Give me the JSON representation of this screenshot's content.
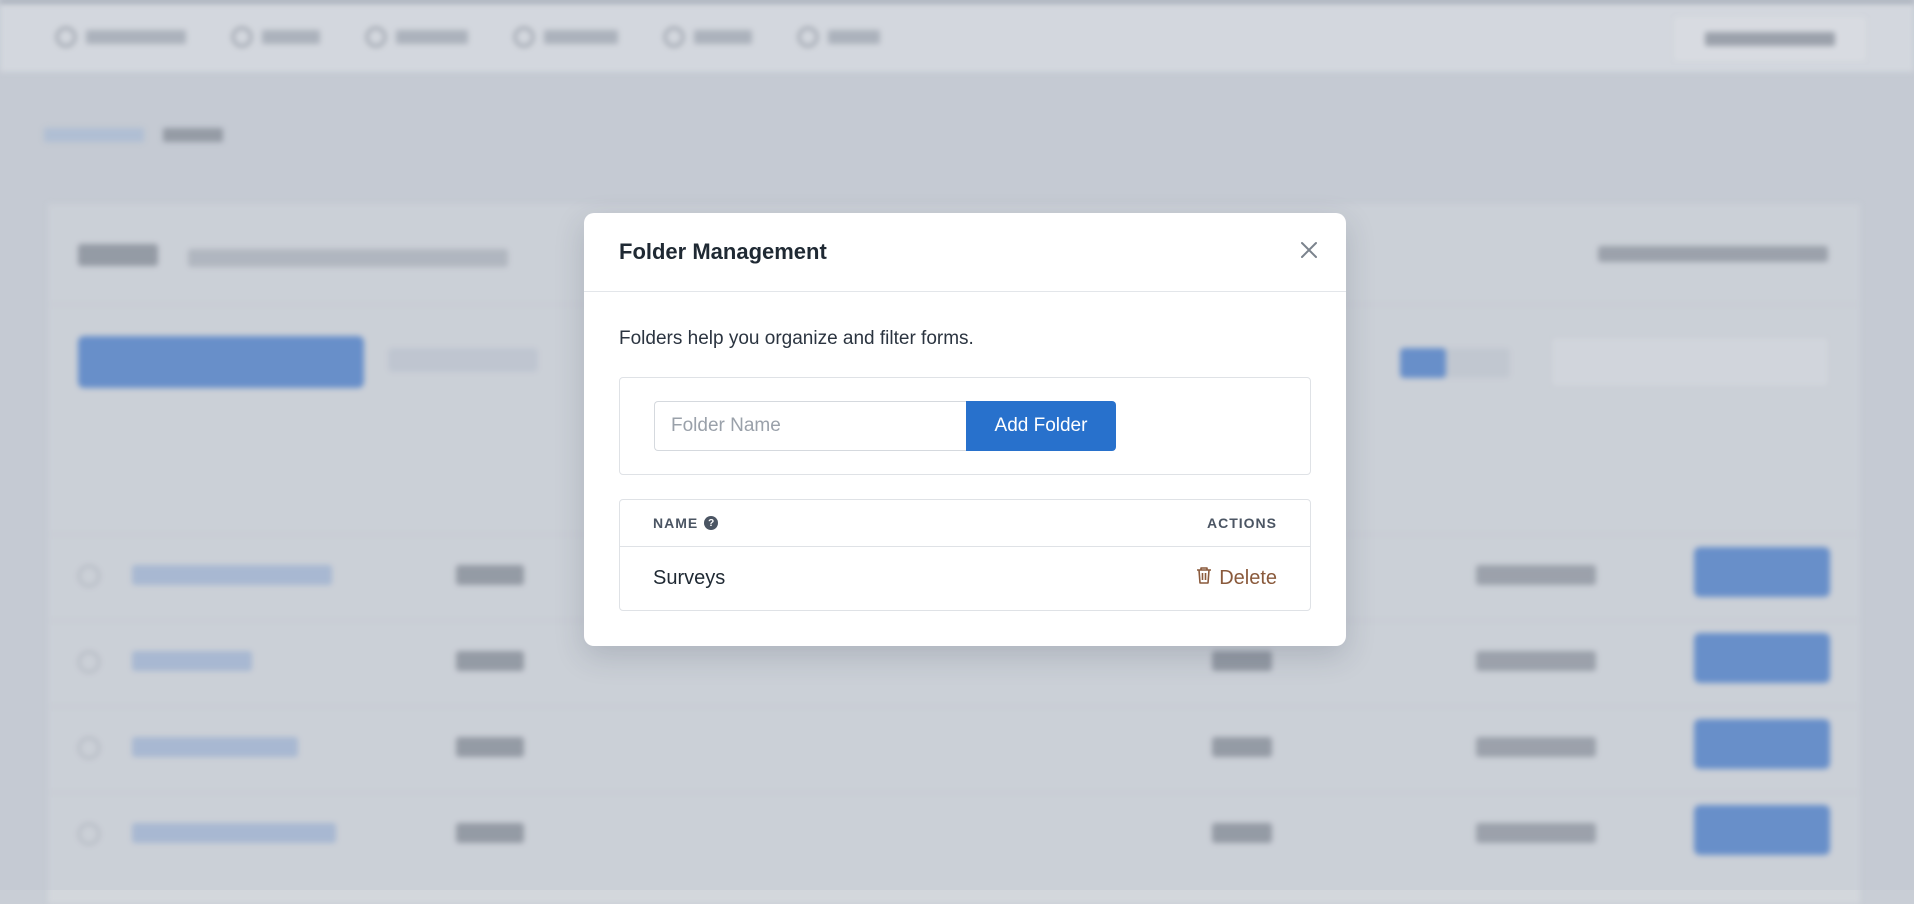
{
  "modal": {
    "title": "Folder Management",
    "description": "Folders help you organize and filter forms.",
    "input": {
      "placeholder": "Folder Name",
      "value": ""
    },
    "add_button": "Add Folder",
    "table": {
      "headers": {
        "name": "NAME",
        "actions": "ACTIONS"
      },
      "rows": [
        {
          "name": "Surveys",
          "action": "Delete"
        }
      ]
    }
  },
  "colors": {
    "primary": "#2871cc",
    "delete": "#8a5a3c"
  },
  "icons": {
    "close": "close-icon",
    "help": "help-icon",
    "delete": "trash-icon"
  }
}
